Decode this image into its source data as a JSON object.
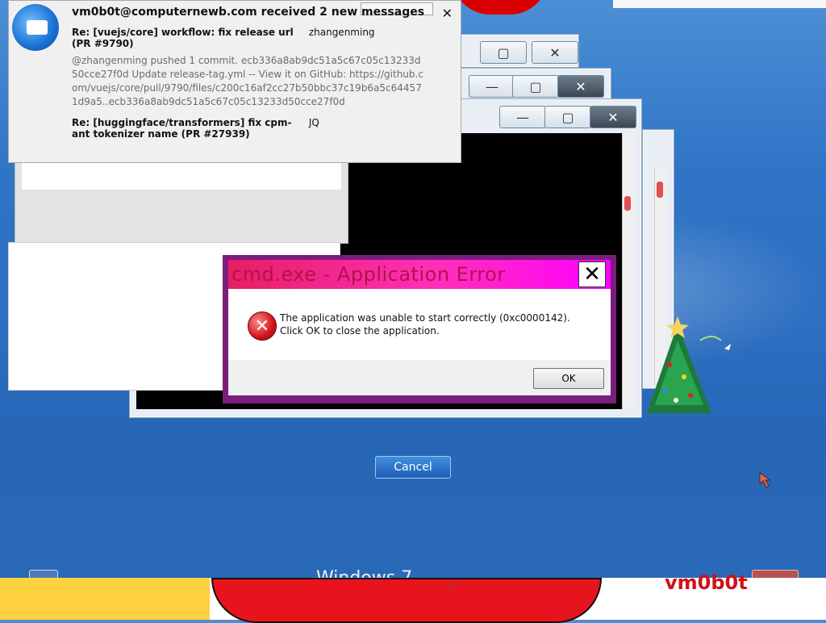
{
  "notification": {
    "title": "vm0b0t@computernewb.com received 2 new messages",
    "close_glyph": "✕",
    "messages": [
      {
        "subject": "Re: [vuejs/core] workflow: fix release url (PR #9790)",
        "from": "zhangenming",
        "preview": "@zhangenming pushed 1 commit. ecb336a8ab9dc51a5c67c05c13233d50cce27f0d Update release-tag.yml -- View it on GitHub: https://github.com/vuejs/core/pull/9790/files/c200c16af2cc27b50bbc37c19b6a5c644571d9a5..ecb336a8ab9dc51a5c67c05c13233d50cce27f0d"
      },
      {
        "subject": "Re: [huggingface/transformers] fix cpm-ant tokenizer name (PR #27939)",
        "from": "JQ",
        "preview": ""
      }
    ]
  },
  "dialog": {
    "title": "cmd.exe - Application Error",
    "close_glyph": "✕",
    "message": "The application was unable to start correctly (0xc0000142). Click OK to close the application.",
    "ok_label": "OK",
    "error_icon_glyph": "✕"
  },
  "window_controls": {
    "minimize": "—",
    "maximize": "▢",
    "close": "✕"
  },
  "desktop": {
    "cancel_label": "Cancel",
    "windows_logo_text": "Windows 7",
    "bottom_text": "vm0b0t"
  }
}
